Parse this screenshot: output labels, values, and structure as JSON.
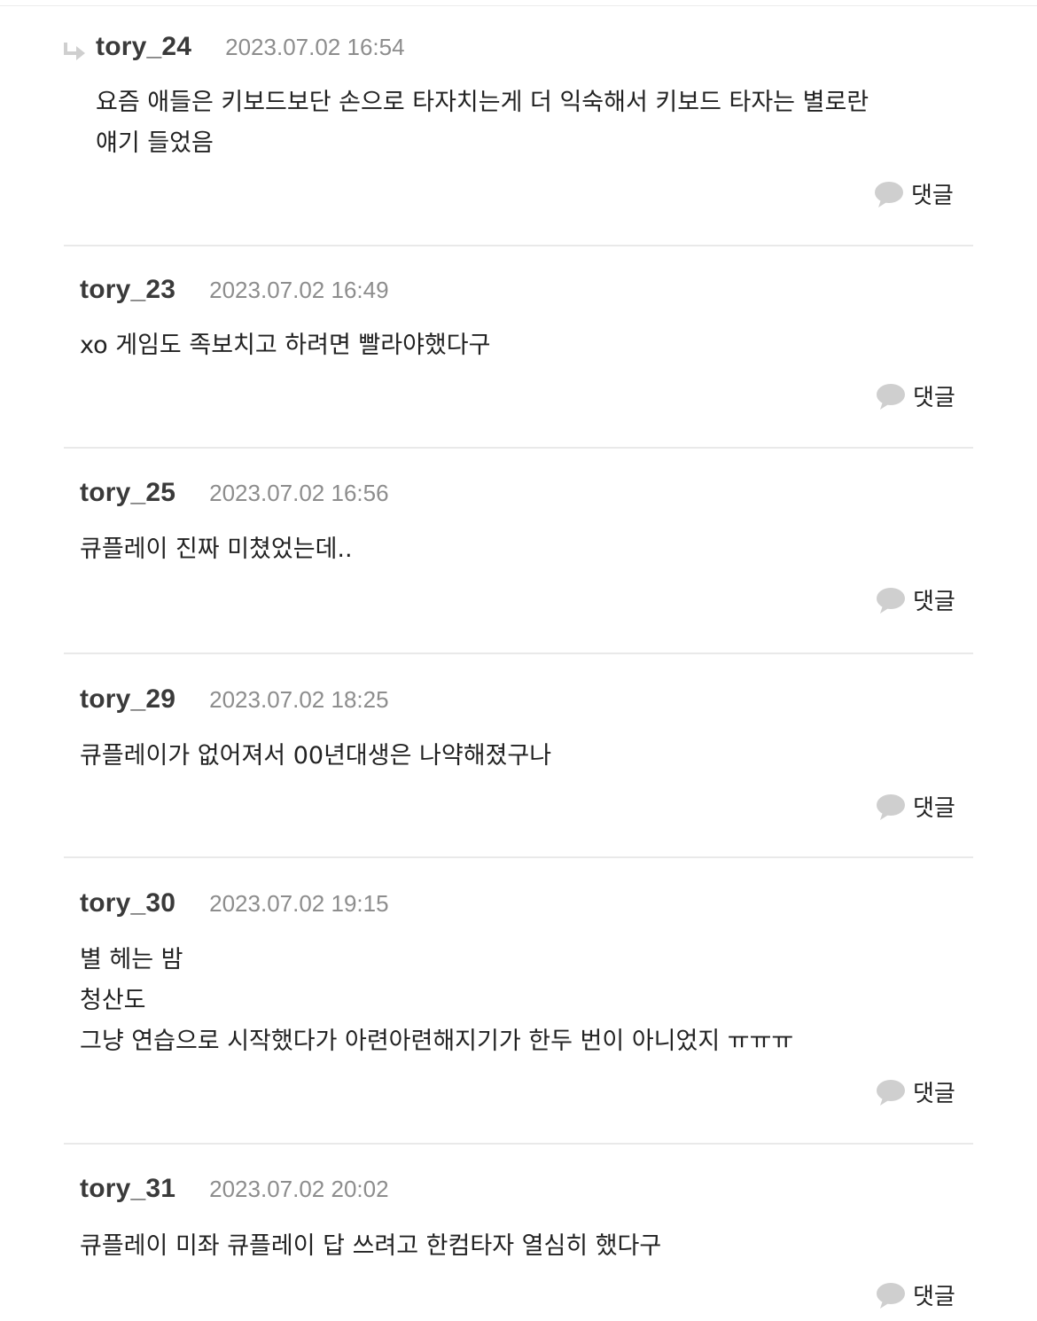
{
  "reply_label": "댓글",
  "comments": [
    {
      "author": "tory_24",
      "date": "2023.07.02 16:54",
      "is_reply": true,
      "lines": [
        "요즘 애들은 키보드보단 손으로 타자치는게 더 익숙해서 키보드 타자는 별로란",
        "얘기 들었음"
      ]
    },
    {
      "author": "tory_23",
      "date": "2023.07.02 16:49",
      "is_reply": false,
      "lines": [
        "xo 게임도 족보치고 하려면 빨라야했다구"
      ]
    },
    {
      "author": "tory_25",
      "date": "2023.07.02 16:56",
      "is_reply": false,
      "lines": [
        "큐플레이 진짜 미쳤었는데.."
      ]
    },
    {
      "author": "tory_29",
      "date": "2023.07.02 18:25",
      "is_reply": false,
      "lines": [
        "큐플레이가 없어져서 00년대생은 나약해졌구나"
      ]
    },
    {
      "author": "tory_30",
      "date": "2023.07.02 19:15",
      "is_reply": false,
      "lines": [
        "별 헤는 밤",
        "청산도",
        "그냥 연습으로 시작했다가 아련아련해지기가 한두 번이 아니었지 ㅠㅠㅠ"
      ]
    },
    {
      "author": "tory_31",
      "date": "2023.07.02 20:02",
      "is_reply": false,
      "lines": [
        "큐플레이 미좌 큐플레이 답 쓰려고 한컴타자 열심히 했다구"
      ]
    }
  ],
  "colors": {
    "author": "#3a3a3a",
    "date": "#8d8d8d",
    "text": "#222222",
    "divider": "#e9e9e9",
    "bubble_icon": "#cfcfcf"
  },
  "icons": {
    "reply_indicator": "reply-arrow-icon",
    "comment": "speech-bubble-icon"
  }
}
